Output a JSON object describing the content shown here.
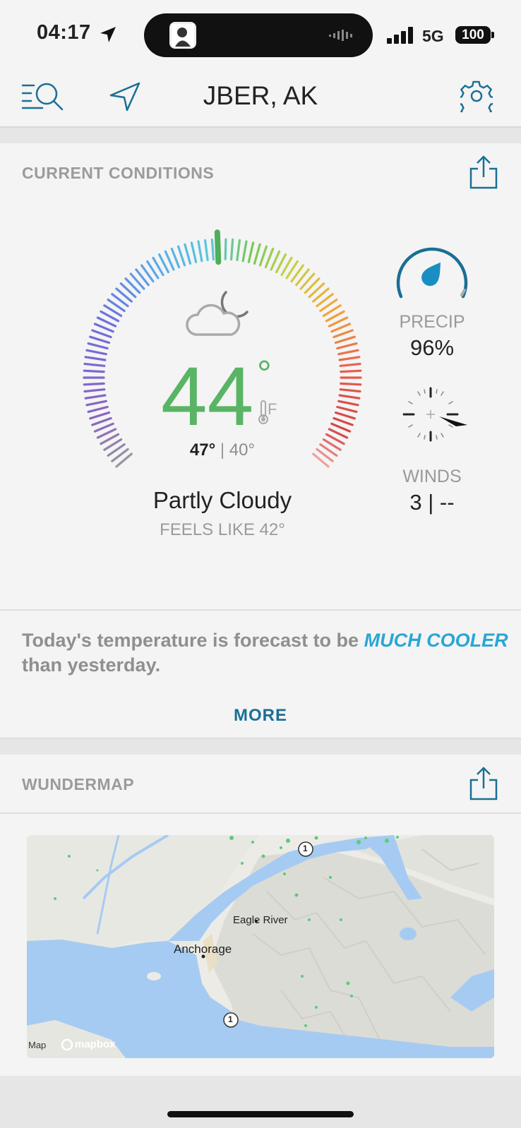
{
  "status_bar": {
    "time": "04:17",
    "network": "5G",
    "battery": "100"
  },
  "header": {
    "location": "JBER, AK",
    "icons": [
      "search-list-icon",
      "location-arrow-icon",
      "gear-icon"
    ]
  },
  "current_conditions": {
    "title": "CURRENT CONDITIONS",
    "temperature": "44",
    "degree_symbol": "°",
    "unit": "F",
    "high": "47°",
    "separator": "|",
    "low": "40°",
    "condition": "Partly Cloudy",
    "feels_like": "FEELS LIKE 42°",
    "precip_label": "PRECIP",
    "precip_value": "96%",
    "winds_label": "WINDS",
    "winds_value": "3 | --",
    "gauge_scale_min_f": -20,
    "gauge_scale_max_f": 110,
    "condition_icon": "partly-cloudy-night-icon"
  },
  "forecast_note": {
    "before": "Today's temperature is forecast to be ",
    "emphasis": "MUCH COOLER",
    "after": " than yesterday.",
    "more_label": "MORE"
  },
  "wundermap": {
    "title": "WUNDERMAP",
    "labels": {
      "eagle_river": "Eagle River",
      "anchorage": "Anchorage",
      "route_1a": "1",
      "route_1b": "1",
      "map_attribution": "Map",
      "mapbox": "mapbox"
    }
  },
  "colors": {
    "accent": "#1a6f94",
    "temp_green": "#59b465",
    "highlight_blue": "#2aa6d6",
    "water": "#a6cbf2"
  }
}
